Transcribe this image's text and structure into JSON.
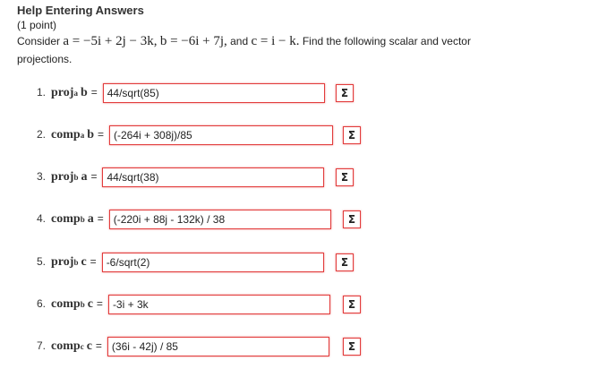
{
  "problem": {
    "title": "Help Entering Answers",
    "points": "(1 point)",
    "consider": "Consider",
    "a_eq": "a = −5i + 2j − 3k,",
    "b_eq": "b = −6i + 7j,",
    "and": "and",
    "c_eq": "c = i − k.",
    "instruction_1": "Find the following scalar and vector",
    "instruction_2": "projections."
  },
  "sigma_symbol": "Σ",
  "items": [
    {
      "num": "1.",
      "op": "proj",
      "sub": "a",
      "vec": "b",
      "eq": "=",
      "value": "44/sqrt(85)"
    },
    {
      "num": "2.",
      "op": "comp",
      "sub": "a",
      "vec": "b",
      "eq": "=",
      "value": "(-264i + 308j)/85"
    },
    {
      "num": "3.",
      "op": "proj",
      "sub": "b",
      "vec": "a",
      "eq": "=",
      "value": "44/sqrt(38)"
    },
    {
      "num": "4.",
      "op": "comp",
      "sub": "b",
      "vec": "a",
      "eq": "=",
      "value": "(-220i + 88j - 132k) / 38"
    },
    {
      "num": "5.",
      "op": "proj",
      "sub": "b",
      "vec": "c",
      "eq": "=",
      "value": "-6/sqrt(2)"
    },
    {
      "num": "6.",
      "op": "comp",
      "sub": "b",
      "vec": "c",
      "eq": "=",
      "value": "-3i + 3k"
    },
    {
      "num": "7.",
      "op": "comp",
      "sub": "c",
      "vec": "c",
      "eq": "=",
      "value": "(36i - 42j) / 85"
    }
  ]
}
